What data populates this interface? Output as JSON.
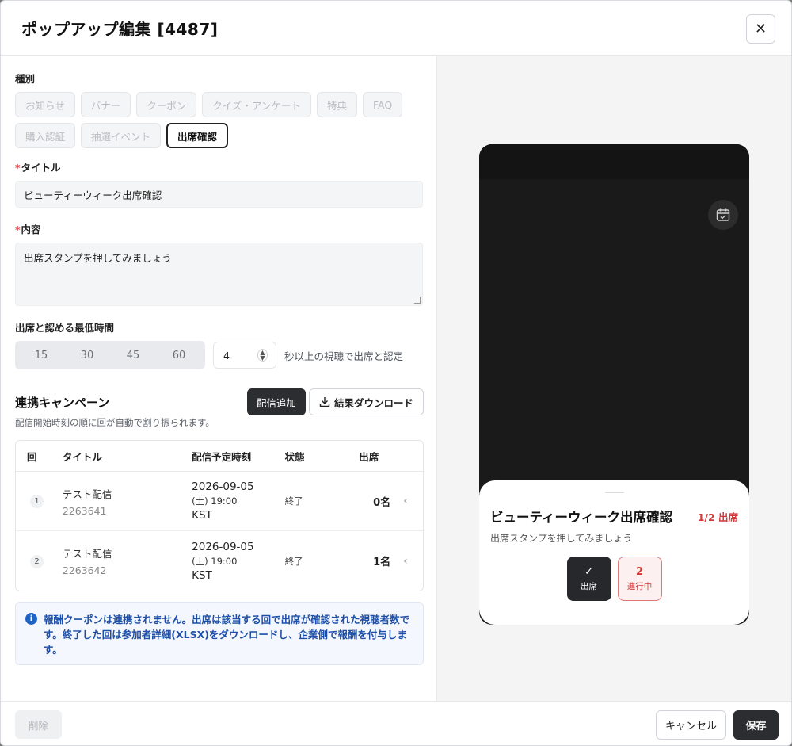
{
  "modal": {
    "title": "ポップアップ編集 [4487]"
  },
  "type_section": {
    "label": "種別",
    "chips": [
      "お知らせ",
      "バナー",
      "クーポン",
      "クイズ・アンケート",
      "特典",
      "FAQ",
      "購入認証",
      "抽選イベント",
      "出席確認"
    ],
    "active": "出席確認"
  },
  "title_field": {
    "required_mark": "*",
    "label": "タイトル",
    "value": "ビューティーウィーク出席確認"
  },
  "content_field": {
    "required_mark": "*",
    "label": "内容",
    "value": "出席スタンプを押してみましょう"
  },
  "min_time": {
    "label": "出席と認める最低時間",
    "options": [
      "15",
      "30",
      "45",
      "60"
    ],
    "value": "4",
    "note": "秒以上の視聴で出席と認定"
  },
  "campaign": {
    "title": "連携キャンペーン",
    "subtitle": "配信開始時刻の順に回が自動で割り振られます。",
    "add_button": "配信追加",
    "download_button": "結果ダウンロード",
    "columns": [
      "回",
      "タイトル",
      "配信予定時刻",
      "状態",
      "出席"
    ],
    "rows": [
      {
        "no": "1",
        "title": "テスト配信",
        "id": "2263641",
        "date": "2026-09-05",
        "time": "(土) 19:00",
        "tz": "KST",
        "state": "終了",
        "attendance": "0名"
      },
      {
        "no": "2",
        "title": "テスト配信",
        "id": "2263642",
        "date": "2026-09-05",
        "time": "(土) 19:00",
        "tz": "KST",
        "state": "終了",
        "attendance": "1名"
      }
    ]
  },
  "notice": {
    "icon": "info-icon",
    "text": "報酬クーポンは連携されません。出席は該当する回で出席が確認された視聴者数です。終了した回は参加者詳細(XLSX)をダウンロードし、企業側で報酬を付与します。"
  },
  "footer": {
    "delete": "削除",
    "cancel": "キャンセル",
    "save": "保存"
  },
  "preview": {
    "title": "ビューティーウィーク出席確認",
    "count": "1/2 出席",
    "message": "出席スタンプを押してみましょう",
    "stamps": [
      {
        "top": "✓",
        "label": "出席",
        "status": "done"
      },
      {
        "top": "2",
        "label": "進行中",
        "status": "progress"
      }
    ]
  },
  "colors": {
    "accent_dark": "#2b2d31",
    "danger": "#d23a3a",
    "info": "#1e64c8"
  }
}
